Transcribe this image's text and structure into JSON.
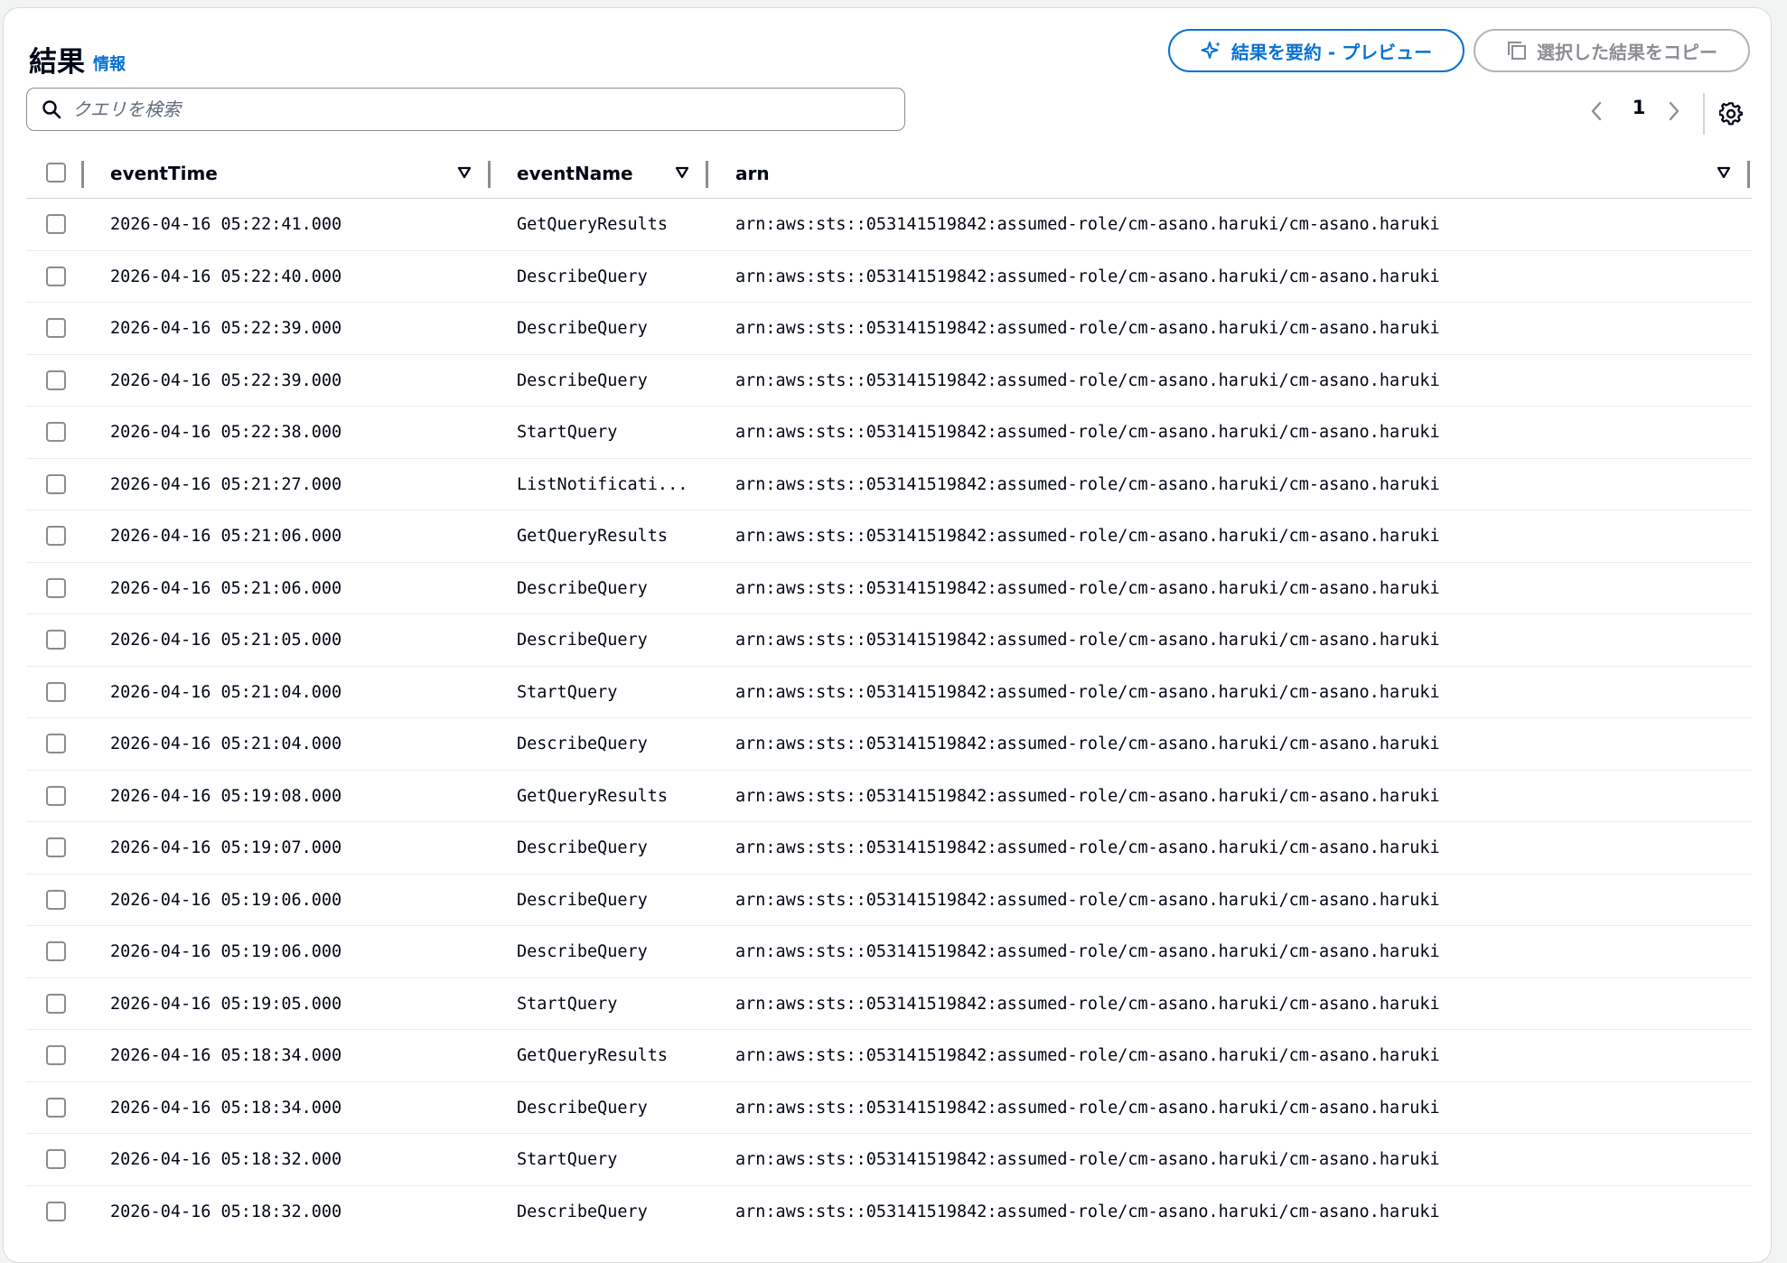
{
  "header": {
    "title": "結果",
    "info_link": "情報",
    "summarize_button": "結果を要約 - プレビュー",
    "copy_button": "選択した結果をコピー"
  },
  "search": {
    "placeholder": "クエリを検索"
  },
  "pagination": {
    "current_page": "1"
  },
  "table": {
    "columns": [
      "eventTime",
      "eventName",
      "arn"
    ],
    "rows": [
      {
        "eventTime": "2026-04-16 05:22:41.000",
        "eventName": "GetQueryResults",
        "arn": "arn:aws:sts::053141519842:assumed-role/cm-asano.haruki/cm-asano.haruki"
      },
      {
        "eventTime": "2026-04-16 05:22:40.000",
        "eventName": "DescribeQuery",
        "arn": "arn:aws:sts::053141519842:assumed-role/cm-asano.haruki/cm-asano.haruki"
      },
      {
        "eventTime": "2026-04-16 05:22:39.000",
        "eventName": "DescribeQuery",
        "arn": "arn:aws:sts::053141519842:assumed-role/cm-asano.haruki/cm-asano.haruki"
      },
      {
        "eventTime": "2026-04-16 05:22:39.000",
        "eventName": "DescribeQuery",
        "arn": "arn:aws:sts::053141519842:assumed-role/cm-asano.haruki/cm-asano.haruki"
      },
      {
        "eventTime": "2026-04-16 05:22:38.000",
        "eventName": "StartQuery",
        "arn": "arn:aws:sts::053141519842:assumed-role/cm-asano.haruki/cm-asano.haruki"
      },
      {
        "eventTime": "2026-04-16 05:21:27.000",
        "eventName": "ListNotificati...",
        "arn": "arn:aws:sts::053141519842:assumed-role/cm-asano.haruki/cm-asano.haruki"
      },
      {
        "eventTime": "2026-04-16 05:21:06.000",
        "eventName": "GetQueryResults",
        "arn": "arn:aws:sts::053141519842:assumed-role/cm-asano.haruki/cm-asano.haruki"
      },
      {
        "eventTime": "2026-04-16 05:21:06.000",
        "eventName": "DescribeQuery",
        "arn": "arn:aws:sts::053141519842:assumed-role/cm-asano.haruki/cm-asano.haruki"
      },
      {
        "eventTime": "2026-04-16 05:21:05.000",
        "eventName": "DescribeQuery",
        "arn": "arn:aws:sts::053141519842:assumed-role/cm-asano.haruki/cm-asano.haruki"
      },
      {
        "eventTime": "2026-04-16 05:21:04.000",
        "eventName": "StartQuery",
        "arn": "arn:aws:sts::053141519842:assumed-role/cm-asano.haruki/cm-asano.haruki"
      },
      {
        "eventTime": "2026-04-16 05:21:04.000",
        "eventName": "DescribeQuery",
        "arn": "arn:aws:sts::053141519842:assumed-role/cm-asano.haruki/cm-asano.haruki"
      },
      {
        "eventTime": "2026-04-16 05:19:08.000",
        "eventName": "GetQueryResults",
        "arn": "arn:aws:sts::053141519842:assumed-role/cm-asano.haruki/cm-asano.haruki"
      },
      {
        "eventTime": "2026-04-16 05:19:07.000",
        "eventName": "DescribeQuery",
        "arn": "arn:aws:sts::053141519842:assumed-role/cm-asano.haruki/cm-asano.haruki"
      },
      {
        "eventTime": "2026-04-16 05:19:06.000",
        "eventName": "DescribeQuery",
        "arn": "arn:aws:sts::053141519842:assumed-role/cm-asano.haruki/cm-asano.haruki"
      },
      {
        "eventTime": "2026-04-16 05:19:06.000",
        "eventName": "DescribeQuery",
        "arn": "arn:aws:sts::053141519842:assumed-role/cm-asano.haruki/cm-asano.haruki"
      },
      {
        "eventTime": "2026-04-16 05:19:05.000",
        "eventName": "StartQuery",
        "arn": "arn:aws:sts::053141519842:assumed-role/cm-asano.haruki/cm-asano.haruki"
      },
      {
        "eventTime": "2026-04-16 05:18:34.000",
        "eventName": "GetQueryResults",
        "arn": "arn:aws:sts::053141519842:assumed-role/cm-asano.haruki/cm-asano.haruki"
      },
      {
        "eventTime": "2026-04-16 05:18:34.000",
        "eventName": "DescribeQuery",
        "arn": "arn:aws:sts::053141519842:assumed-role/cm-asano.haruki/cm-asano.haruki"
      },
      {
        "eventTime": "2026-04-16 05:18:32.000",
        "eventName": "StartQuery",
        "arn": "arn:aws:sts::053141519842:assumed-role/cm-asano.haruki/cm-asano.haruki"
      },
      {
        "eventTime": "2026-04-16 05:18:32.000",
        "eventName": "DescribeQuery",
        "arn": "arn:aws:sts::053141519842:assumed-role/cm-asano.haruki/cm-asano.haruki"
      }
    ]
  },
  "colors": {
    "accent": "#0972d3",
    "disabled": "#8d8d95",
    "text": "#000716",
    "border": "#d1d5db"
  }
}
